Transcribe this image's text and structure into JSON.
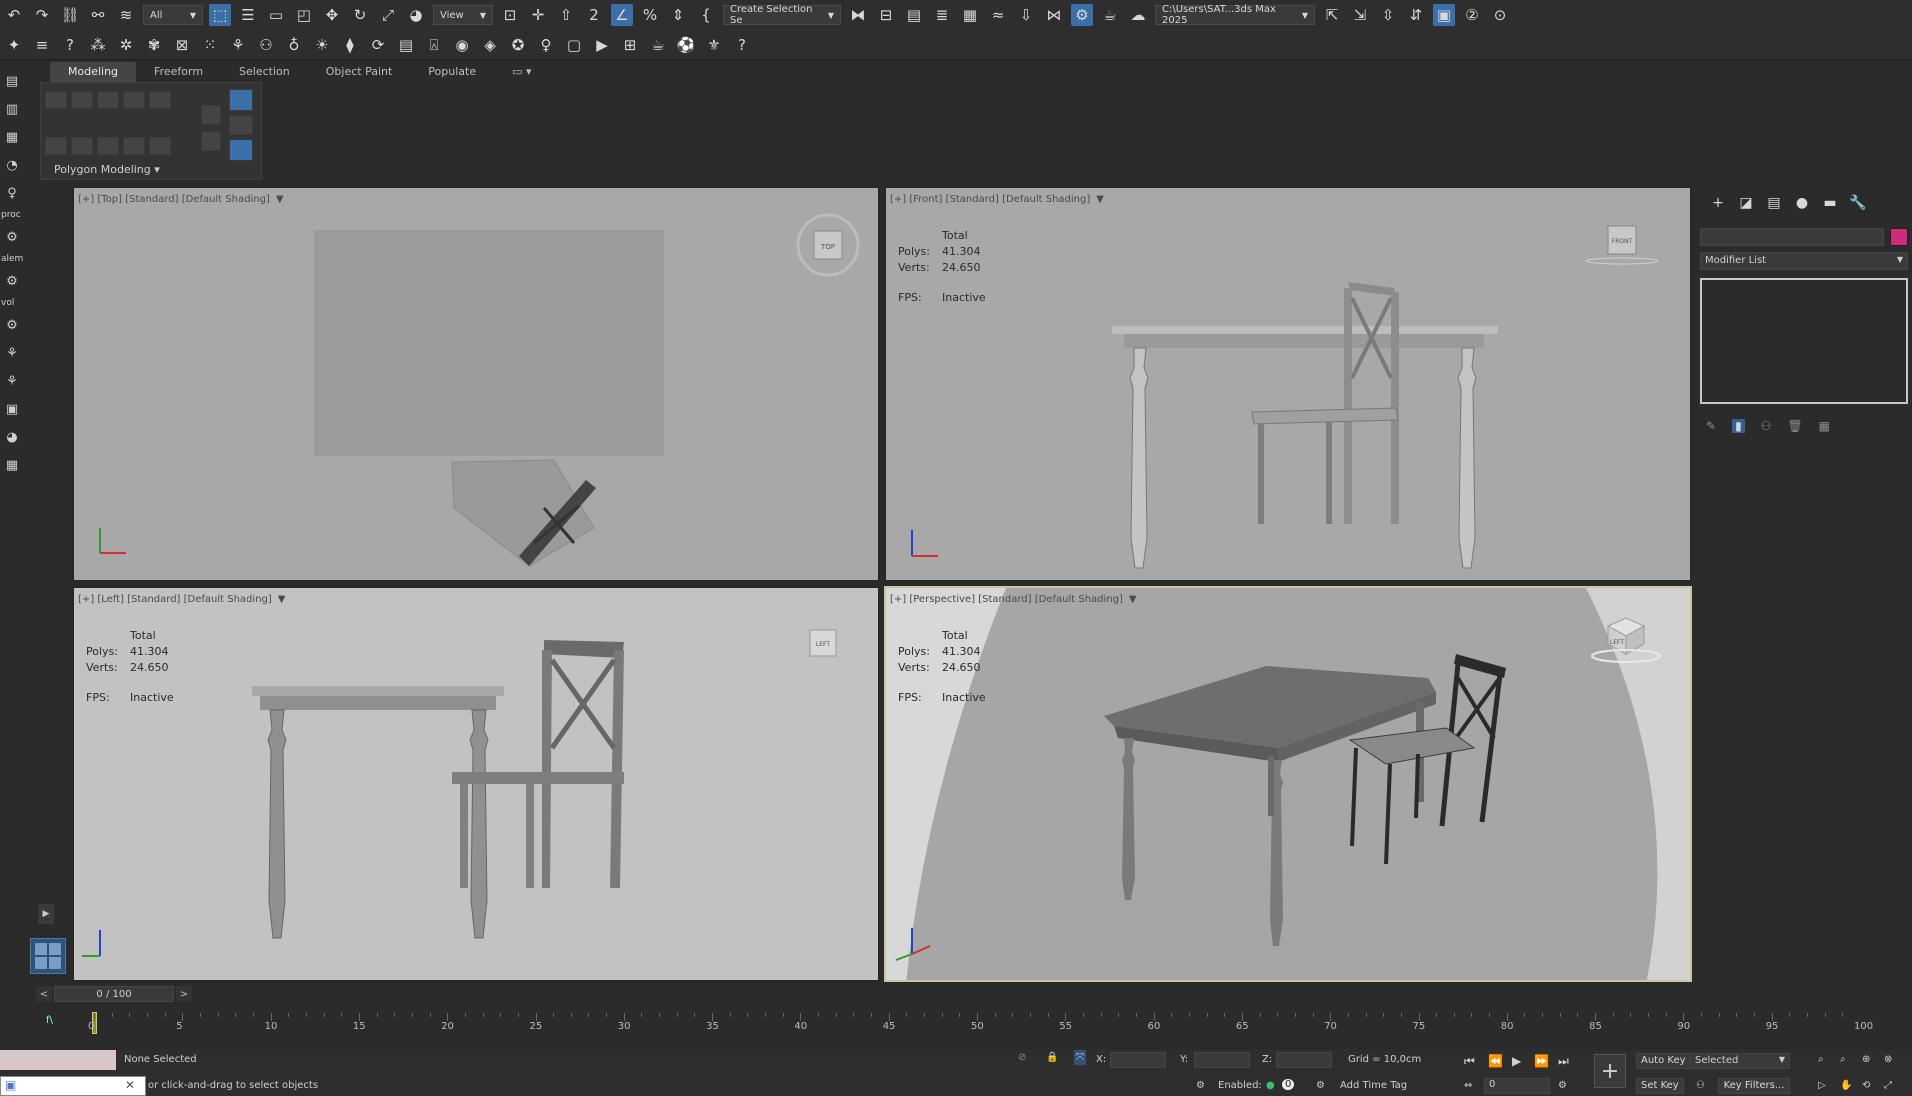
{
  "toolbar_top": {
    "selection_filter": "All",
    "ref_coord": "View",
    "named_selection": "Create Selection Se",
    "project_path": "C:\\Users\\SAT...3ds Max 2025"
  },
  "ribbon": {
    "tabs": [
      "Modeling",
      "Freeform",
      "Selection",
      "Object Paint",
      "Populate"
    ],
    "panel_label": "Polygon Modeling"
  },
  "left_strip": {
    "labels": [
      "proc",
      "alem",
      "vol"
    ]
  },
  "viewports": {
    "top": {
      "label": "[+] [Top] [Standard] [Default Shading]",
      "cube_label": "TOP"
    },
    "front": {
      "label": "[+] [Front] [Standard] [Default Shading]",
      "cube_label": "FRONT",
      "stats": {
        "total": "Total",
        "polys_k": "Polys:",
        "polys_v": "41.304",
        "verts_k": "Verts:",
        "verts_v": "24.650",
        "fps_k": "FPS:",
        "fps_v": "Inactive"
      }
    },
    "left": {
      "label": "[+] [Left] [Standard] [Default Shading]",
      "cube_label": "LEFT",
      "stats": {
        "total": "Total",
        "polys_k": "Polys:",
        "polys_v": "41.304",
        "verts_k": "Verts:",
        "verts_v": "24.650",
        "fps_k": "FPS:",
        "fps_v": "Inactive"
      }
    },
    "perspective": {
      "label": "[+] [Perspective] [Standard] [Default Shading]",
      "cube_label": "LEFT",
      "stats": {
        "total": "Total",
        "polys_k": "Polys:",
        "polys_v": "41.304",
        "verts_k": "Verts:",
        "verts_v": "24.650",
        "fps_k": "FPS:",
        "fps_v": "Inactive"
      }
    }
  },
  "command_panel": {
    "modifier_list": "Modifier List",
    "object_color": "#d02a7b"
  },
  "time": {
    "frame": "0 / 100",
    "prev": "<",
    "next": ">",
    "ticks": [
      "0",
      "5",
      "10",
      "15",
      "20",
      "25",
      "30",
      "35",
      "40",
      "45",
      "50",
      "55",
      "60",
      "65",
      "70",
      "75",
      "80",
      "85",
      "90",
      "95",
      "100"
    ]
  },
  "status": {
    "selection": "None Selected",
    "prompt": "or click-and-drag to select objects",
    "x_label": "X:",
    "y_label": "Y:",
    "z_label": "Z:",
    "grid": "Grid = 10,0cm",
    "enabled": "Enabled:",
    "add_time_tag": "Add Time Tag",
    "auto_key": "Auto Key",
    "set_key": "Set Key",
    "selected": "Selected",
    "key_filters": "Key Filters...",
    "frame_field": "0"
  }
}
